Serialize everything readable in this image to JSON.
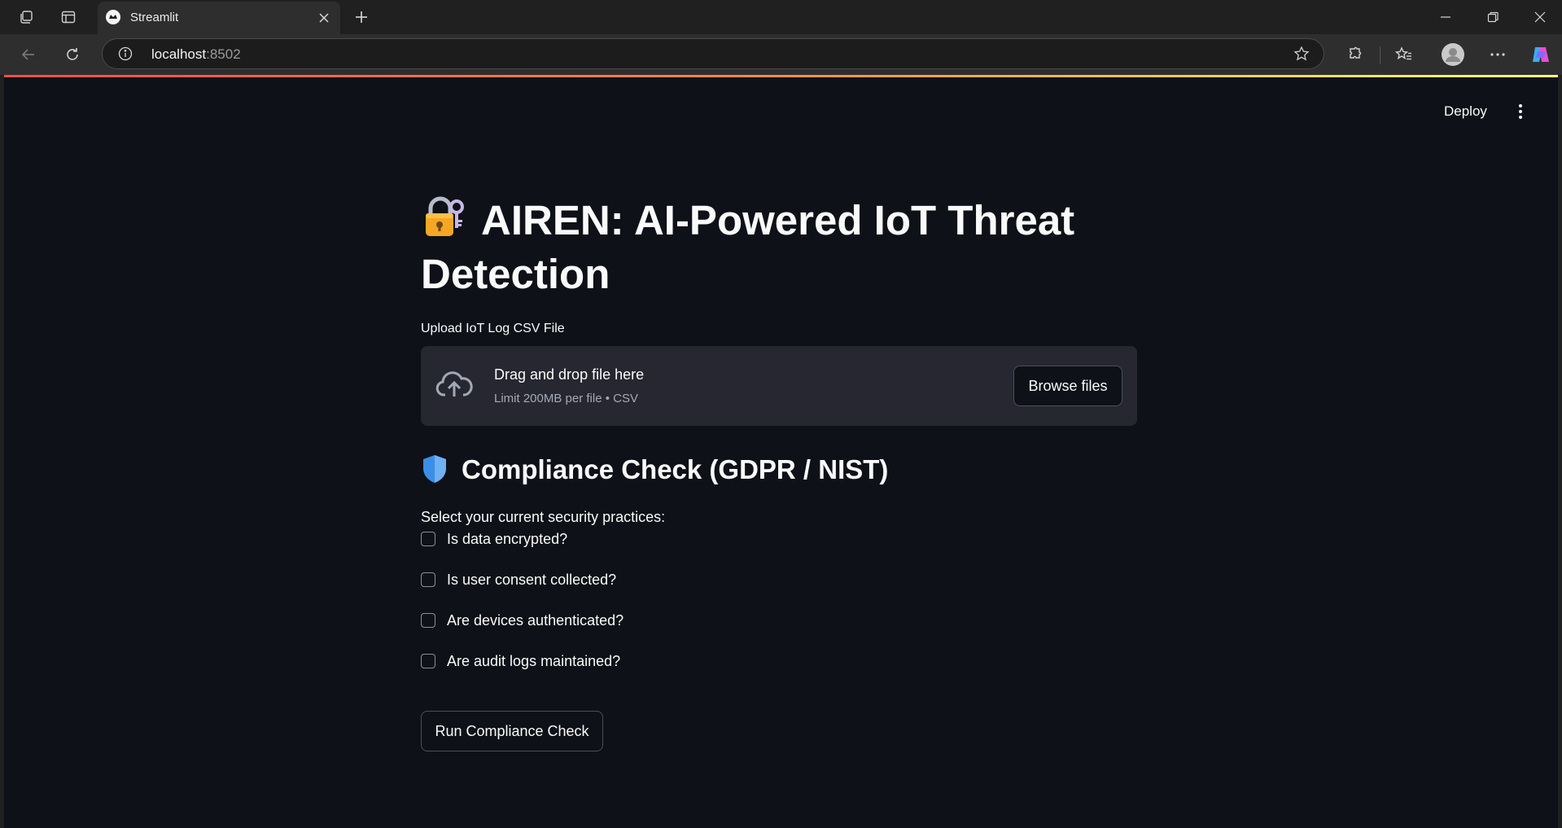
{
  "browser": {
    "tab_title": "Streamlit",
    "url_host": "localhost",
    "url_port": ":8502"
  },
  "app": {
    "deploy_label": "Deploy",
    "title": "AIREN: AI-Powered IoT Threat Detection",
    "upload": {
      "label": "Upload IoT Log CSV File",
      "drop_title": "Drag and drop file here",
      "limit_text": "Limit 200MB per file • CSV",
      "browse_label": "Browse files"
    },
    "compliance": {
      "heading": "Compliance Check (GDPR / NIST)",
      "prompt": "Select your current security practices:",
      "options": [
        {
          "label": "Is data encrypted?",
          "checked": false
        },
        {
          "label": "Is user consent collected?",
          "checked": false
        },
        {
          "label": "Are devices authenticated?",
          "checked": false
        },
        {
          "label": "Are audit logs maintained?",
          "checked": false
        }
      ],
      "run_label": "Run Compliance Check"
    }
  },
  "colors": {
    "app_bg": "#0e1117",
    "dropzone_bg": "#262730",
    "accent": "#ff4b4b"
  }
}
